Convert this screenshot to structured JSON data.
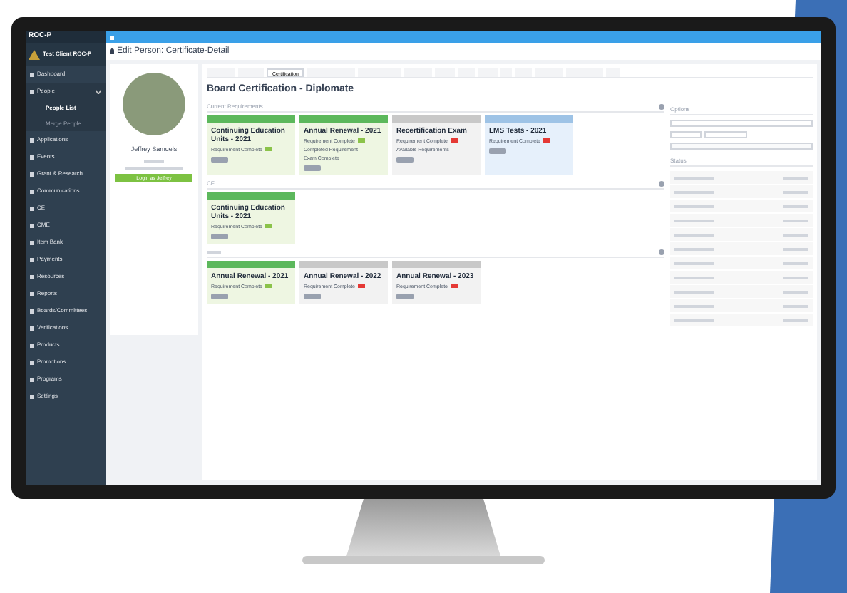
{
  "app": {
    "logo": "ROC-P",
    "org": "Test Client ROC-P"
  },
  "sidebar": {
    "items": [
      {
        "label": "Dashboard",
        "expanded": false,
        "selected": false
      },
      {
        "label": "People",
        "expanded": true,
        "selected": false,
        "children": [
          {
            "label": "People List",
            "selected": true
          },
          {
            "label": "Merge People",
            "selected": false
          }
        ]
      },
      {
        "label": "Applications",
        "expanded": false,
        "selected": false
      },
      {
        "label": "Events",
        "expanded": false,
        "selected": false
      },
      {
        "label": "Grant & Research",
        "expanded": false,
        "selected": false
      },
      {
        "label": "Communications",
        "expanded": false,
        "selected": false
      },
      {
        "label": "CE",
        "expanded": false,
        "selected": false
      },
      {
        "label": "CME",
        "expanded": false,
        "selected": false
      },
      {
        "label": "Item Bank",
        "expanded": false,
        "selected": false
      },
      {
        "label": "Payments",
        "expanded": false,
        "selected": false
      },
      {
        "label": "Resources",
        "expanded": false,
        "selected": false
      },
      {
        "label": "Reports",
        "expanded": false,
        "selected": false
      },
      {
        "label": "Boards/Committees",
        "expanded": false,
        "selected": false
      },
      {
        "label": "Verifications",
        "expanded": false,
        "selected": false
      },
      {
        "label": "Products",
        "expanded": false,
        "selected": false
      },
      {
        "label": "Promotions",
        "expanded": false,
        "selected": false
      },
      {
        "label": "Programs",
        "expanded": false,
        "selected": false
      },
      {
        "label": "Settings",
        "expanded": false,
        "selected": false
      }
    ]
  },
  "page_title": "Edit Person: Certificate-Detail",
  "profile": {
    "name": "Jeffrey Samuels",
    "login_button": "Login as Jeffrey"
  },
  "tabs": [
    {
      "label": "Certification",
      "selected": true
    }
  ],
  "certification": {
    "title": "Board Certification - Diplomate",
    "sections": [
      {
        "heading": "Current Requirements",
        "cards": [
          {
            "title": "Continuing Education Units - 2021",
            "color": "#5cb85c",
            "lines": [
              {
                "text": "Requirement Complete",
                "color": "#8bc34a"
              }
            ]
          },
          {
            "title": "Annual Renewal - 2021",
            "color": "#5cb85c",
            "lines": [
              {
                "text": "Requirement Complete",
                "color": "#8bc34a"
              },
              {
                "text": "Completed Requirement"
              },
              {
                "text": "Exam Complete"
              }
            ]
          },
          {
            "title": "Recertification Exam",
            "color": "#c8c8c8",
            "lines": [
              {
                "text": "Requirement Complete",
                "color": "#e53935"
              },
              {
                "text": "Available Requirements"
              }
            ]
          },
          {
            "title": "LMS Tests - 2021",
            "color": "#9ec3e6",
            "lines": [
              {
                "text": "Requirement Complete",
                "color": "#e53935"
              }
            ]
          }
        ]
      },
      {
        "heading": "CE",
        "cards": [
          {
            "title": "Continuing Education Units - 2021",
            "color": "#5cb85c",
            "lines": [
              {
                "text": "Requirement Complete",
                "color": "#8bc34a"
              }
            ]
          }
        ]
      },
      {
        "cards": [
          {
            "title": "Annual Renewal - 2021",
            "color": "#5cb85c",
            "lines": [
              {
                "text": "Requirement Complete",
                "color": "#8bc34a"
              }
            ]
          },
          {
            "title": "Annual Renewal - 2022",
            "color": "#c8c8c8",
            "lines": [
              {
                "text": "Requirement Complete",
                "color": "#e53935"
              }
            ]
          },
          {
            "title": "Annual Renewal - 2023",
            "color": "#c8c8c8",
            "lines": [
              {
                "text": "Requirement Complete",
                "color": "#e53935"
              }
            ]
          }
        ]
      }
    ]
  },
  "options": {
    "heading": "Options",
    "status_heading": "Status"
  }
}
